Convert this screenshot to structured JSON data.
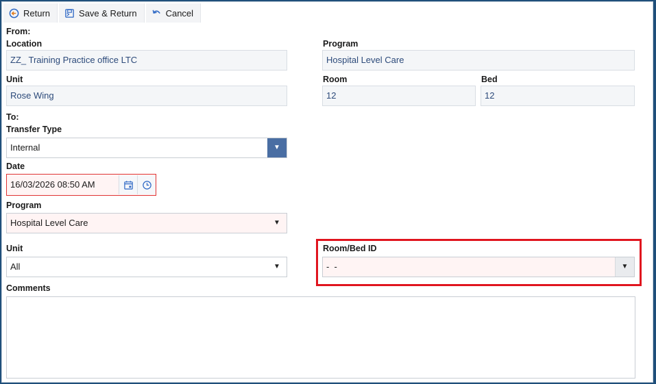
{
  "toolbar": {
    "return_label": "Return",
    "save_return_label": "Save & Return",
    "cancel_label": "Cancel",
    "icons": [
      "return-icon",
      "save-icon",
      "undo-icon"
    ]
  },
  "from": {
    "heading": "From:",
    "location_label": "Location",
    "location_value": "ZZ_ Training Practice office LTC",
    "program_label": "Program",
    "program_value": "Hospital Level Care",
    "unit_label": "Unit",
    "unit_value": "Rose Wing",
    "room_label": "Room",
    "room_value": "12",
    "bed_label": "Bed",
    "bed_value": "12"
  },
  "to": {
    "heading": "To:",
    "transfer_type_label": "Transfer Type",
    "transfer_type_value": "Internal",
    "date_label": "Date",
    "date_value": "16/03/2026 08:50 AM",
    "program_label": "Program",
    "program_value": "Hospital Level Care",
    "unit_label": "Unit",
    "unit_value": "All",
    "room_bed_label": "Room/Bed ID",
    "room_bed_value": "-  -",
    "comments_label": "Comments",
    "comments_value": ""
  },
  "colors": {
    "accent": "#4a6ea3",
    "error_border": "#e03131",
    "highlight": "#e0141e",
    "readonly_text": "#2c4a7a"
  }
}
